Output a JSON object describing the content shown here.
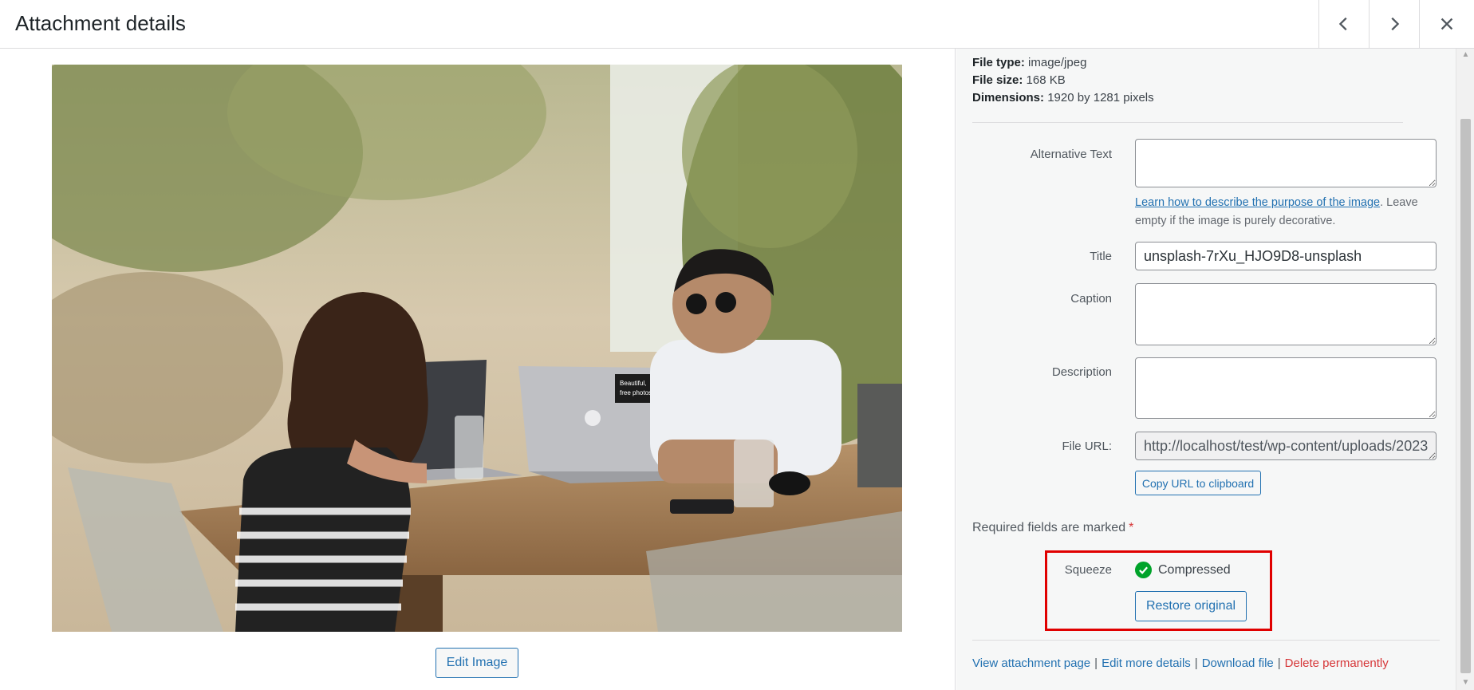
{
  "header": {
    "title": "Attachment details",
    "prev_icon": "chevron-left-icon",
    "next_icon": "chevron-right-icon",
    "close_icon": "close-icon"
  },
  "media": {
    "edit_image_label": "Edit Image",
    "photo_laptop_sticker_line1": "Beautiful,",
    "photo_laptop_sticker_line2": "free photos."
  },
  "details": {
    "file_type_label": "File type:",
    "file_type_value": "image/jpeg",
    "file_size_label": "File size:",
    "file_size_value": "168 KB",
    "dimensions_label": "Dimensions:",
    "dimensions_value": "1920 by 1281 pixels"
  },
  "fields": {
    "alt_text_label": "Alternative Text",
    "alt_text_value": "",
    "alt_help_link": "Learn how to describe the purpose of the image",
    "alt_help_rest": ". Leave empty if the image is purely decorative.",
    "title_label": "Title",
    "title_value": "unsplash-7rXu_HJO9D8-unsplash",
    "caption_label": "Caption",
    "caption_value": "",
    "description_label": "Description",
    "description_value": "",
    "file_url_label": "File URL:",
    "file_url_value": "http://localhost/test/wp-content/uploads/2023",
    "copy_url_label": "Copy URL to clipboard"
  },
  "required_note": "Required fields are marked",
  "required_star": "*",
  "squeeze": {
    "label": "Squeeze",
    "status": "Compressed",
    "status_icon": "check-circle-icon",
    "restore_label": "Restore original"
  },
  "actions": {
    "view_page": "View attachment page",
    "edit_details": "Edit more details",
    "download": "Download file",
    "delete": "Delete permanently",
    "separator": "|"
  },
  "colors": {
    "accent": "#2271b1",
    "delete": "#d63638",
    "success": "#00a32a",
    "highlight": "#e00000"
  }
}
